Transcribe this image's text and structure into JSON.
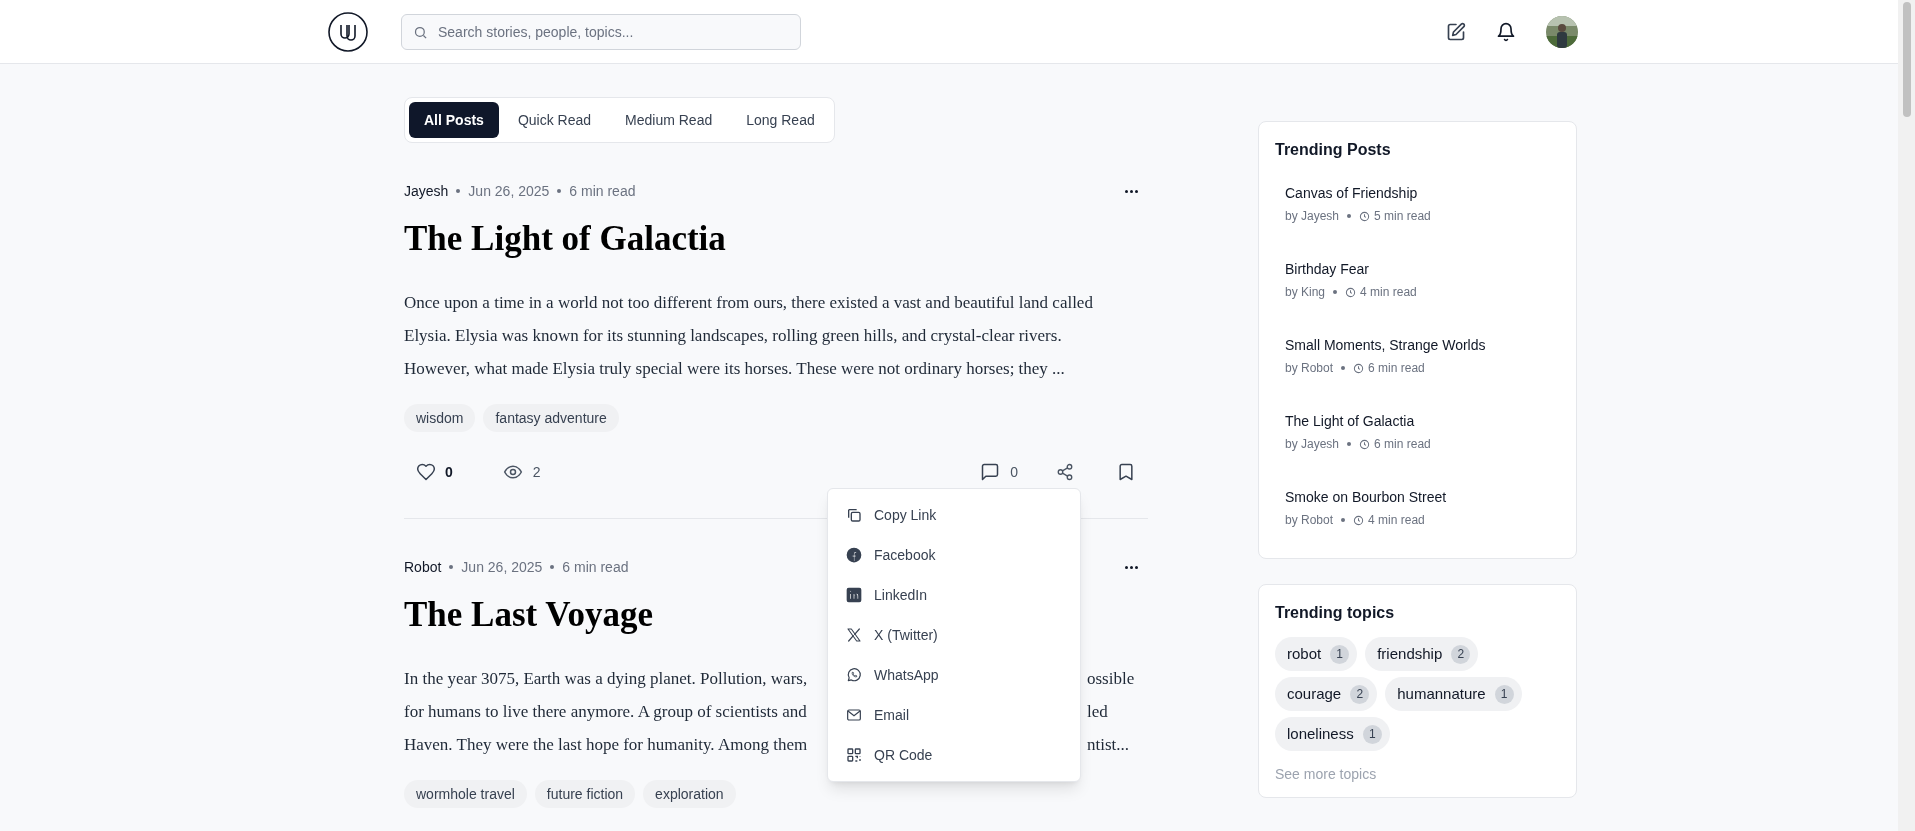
{
  "header": {
    "search": {
      "placeholder": "Search stories, people, topics..."
    }
  },
  "filters": [
    {
      "label": "All Posts",
      "selected": true
    },
    {
      "label": "Quick Read",
      "selected": false
    },
    {
      "label": "Medium Read",
      "selected": false
    },
    {
      "label": "Long Read",
      "selected": false
    }
  ],
  "posts": [
    {
      "author": "Jayesh",
      "date": "Jun 26, 2025",
      "read_time": "6 min read",
      "title": "The Light of Galactia",
      "excerpt_lines": [
        {
          "text": "Once upon a time in a world not too different from ours, there existed a vast and beautiful land called"
        },
        {
          "text": "Elysia. Elysia was known for its stunning landscapes, rolling green hills, and crystal-clear rivers."
        },
        {
          "text": "However, what made Elysia truly special were its horses. These were not ordinary horses; they ..."
        }
      ],
      "tags": [
        "wisdom",
        "fantasy adventure"
      ],
      "likes": "0",
      "views": "2",
      "comments": "0"
    },
    {
      "author": "Robot",
      "date": "Jun 26, 2025",
      "read_time": "6 min read",
      "title": "The Last Voyage",
      "excerpt_lines": [
        {
          "text": "In the year 3075, Earth was a dying planet. Pollution, wars,",
          "after_menu": "ossible"
        },
        {
          "text": "for humans to live there anymore. A group of scientists and",
          "after_menu": "led"
        },
        {
          "text": "Haven. They were the last hope for humanity. Among them",
          "after_menu": "ntist..."
        }
      ],
      "tags": [
        "wormhole travel",
        "future fiction",
        "exploration"
      ]
    }
  ],
  "share_menu": [
    {
      "kind": "copy",
      "label": "Copy Link"
    },
    {
      "kind": "facebook",
      "label": "Facebook"
    },
    {
      "kind": "linkedin",
      "label": "LinkedIn"
    },
    {
      "kind": "x",
      "label": "X (Twitter)"
    },
    {
      "kind": "whatsapp",
      "label": "WhatsApp"
    },
    {
      "kind": "email",
      "label": "Email"
    },
    {
      "kind": "qr",
      "label": "QR Code"
    }
  ],
  "trending_posts": {
    "title": "Trending Posts",
    "items": [
      {
        "title": "Canvas of Friendship",
        "author": "by Jayesh",
        "read_time": "5 min read"
      },
      {
        "title": "Birthday Fear",
        "author": "by King",
        "read_time": "4 min read"
      },
      {
        "title": "Small Moments, Strange Worlds",
        "author": "by Robot",
        "read_time": "6 min read"
      },
      {
        "title": "The Light of Galactia",
        "author": "by Jayesh",
        "read_time": "6 min read"
      },
      {
        "title": "Smoke on Bourbon Street",
        "author": "by Robot",
        "read_time": "4 min read"
      }
    ]
  },
  "trending_topics": {
    "title": "Trending topics",
    "topics": [
      {
        "name": "robot",
        "count": "1"
      },
      {
        "name": "friendship",
        "count": "2"
      },
      {
        "name": "courage",
        "count": "2"
      },
      {
        "name": "humannature",
        "count": "1"
      },
      {
        "name": "loneliness",
        "count": "1"
      }
    ],
    "link": "See more topics"
  }
}
